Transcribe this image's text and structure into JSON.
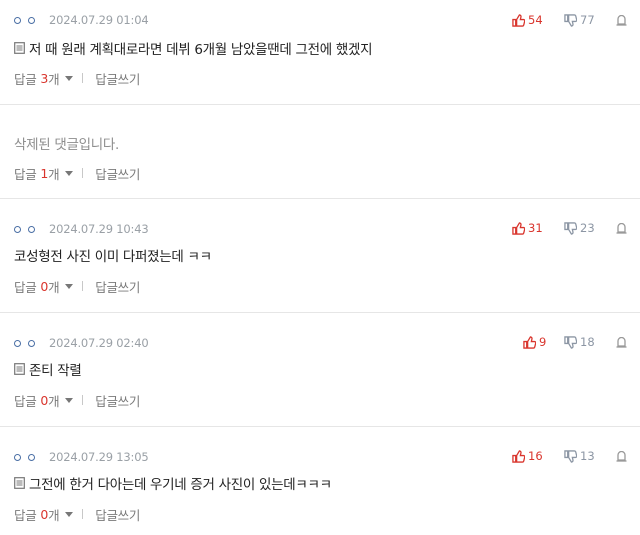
{
  "comments": [
    {
      "date": "2024.07.29 01:04",
      "text": "저 때 원래 계획대로라면 데뷔 6개월 남았을땐데 그전에 했겠지",
      "has_image_icon": true,
      "upvotes": "54",
      "downvotes": "77",
      "reply_label": "답글",
      "reply_count": "3",
      "reply_suffix": "개",
      "write_label": "답글쓰기"
    },
    {
      "deleted_text": "삭제된 댓글입니다.",
      "reply_label": "답글",
      "reply_count": "1",
      "reply_suffix": "개",
      "write_label": "답글쓰기"
    },
    {
      "date": "2024.07.29 10:43",
      "text": "코성형전 사진 이미 다퍼졌는데 ㅋㅋ",
      "has_image_icon": false,
      "upvotes": "31",
      "downvotes": "23",
      "reply_label": "답글",
      "reply_count": "0",
      "reply_suffix": "개",
      "write_label": "답글쓰기"
    },
    {
      "date": "2024.07.29 02:40",
      "text": "존티 작렬",
      "has_image_icon": true,
      "upvotes": "9",
      "downvotes": "18",
      "reply_label": "답글",
      "reply_count": "0",
      "reply_suffix": "개",
      "write_label": "답글쓰기"
    },
    {
      "date": "2024.07.29 13:05",
      "text": "그전에 한거 다아는데 우기네 증거 사진이 있는데ㅋㅋㅋ",
      "has_image_icon": true,
      "upvotes": "16",
      "downvotes": "13",
      "reply_label": "답글",
      "reply_count": "0",
      "reply_suffix": "개",
      "write_label": "답글쓰기"
    }
  ],
  "colors": {
    "upvote": "#d9352d",
    "downvote": "#8c96a4",
    "nick": "#4a6fa5"
  },
  "icons": {
    "upvote": "thumbs-up-icon",
    "downvote": "thumbs-down-icon",
    "report": "report-icon",
    "image": "image-icon",
    "caret": "caret-down-icon"
  }
}
